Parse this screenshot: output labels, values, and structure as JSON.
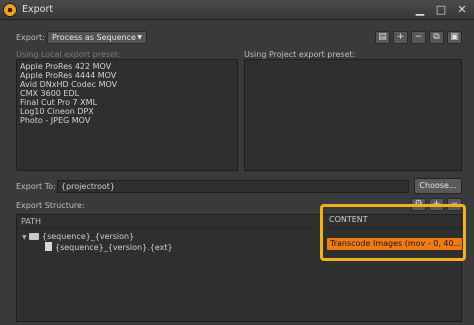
{
  "window": {
    "title": "Export"
  },
  "export_row": {
    "label": "Export:",
    "selected_mode": "Process as Sequence",
    "caret": "▼"
  },
  "toolbar": {
    "doc_icon": "▤",
    "add_icon": "+",
    "remove_icon": "−",
    "copy_icon": "⧉",
    "save_icon": "▣"
  },
  "local_presets": {
    "label": "Using Local export preset:",
    "items": [
      "Apple ProRes 422 MOV",
      "Apple ProRes 4444 MOV",
      "Avid DNxHD Codec MOV",
      "CMX 3600 EDL",
      "Final Cut Pro 7 XML",
      "Log10 Cineon DPX",
      "Photo - JPEG MOV"
    ]
  },
  "project_presets": {
    "label": "Using Project export preset:"
  },
  "export_to": {
    "label": "Export To:",
    "value": "{projectroot}",
    "choose_label": "Choose..."
  },
  "structure": {
    "label": "Export Structure:",
    "path_header": "PATH",
    "content_header": "CONTENT",
    "folder_name": "{sequence}_{version}",
    "file_name": "{sequence}_{version}.{ext}",
    "content_value": "Transcode Images (mov - 0, 40..."
  },
  "colors": {
    "highlight": "#f2b01e",
    "selected_content": "#f07a14"
  }
}
